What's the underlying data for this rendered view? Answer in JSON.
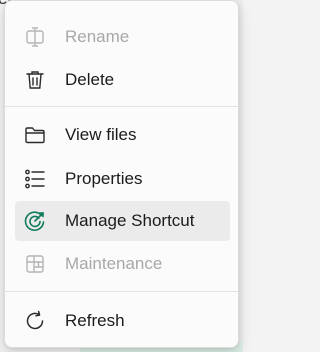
{
  "backdrop": {
    "corner_text": "er"
  },
  "menu": {
    "items": [
      {
        "label": "Rename",
        "icon": "rename-icon",
        "enabled": false
      },
      {
        "label": "Delete",
        "icon": "trash-icon",
        "enabled": true
      },
      {
        "label": "View files",
        "icon": "folder-icon",
        "enabled": true
      },
      {
        "label": "Properties",
        "icon": "list-icon",
        "enabled": true
      },
      {
        "label": "Manage Shortcut",
        "icon": "shortcut-icon",
        "enabled": true,
        "highlighted": true
      },
      {
        "label": "Maintenance",
        "icon": "maintenance-icon",
        "enabled": false
      },
      {
        "label": "Refresh",
        "icon": "refresh-icon",
        "enabled": true
      }
    ]
  },
  "colors": {
    "text": "#1b1b1b",
    "disabled_text": "#a8a8a8",
    "accent": "#0f7b5c",
    "highlight": "#ebebeb"
  }
}
